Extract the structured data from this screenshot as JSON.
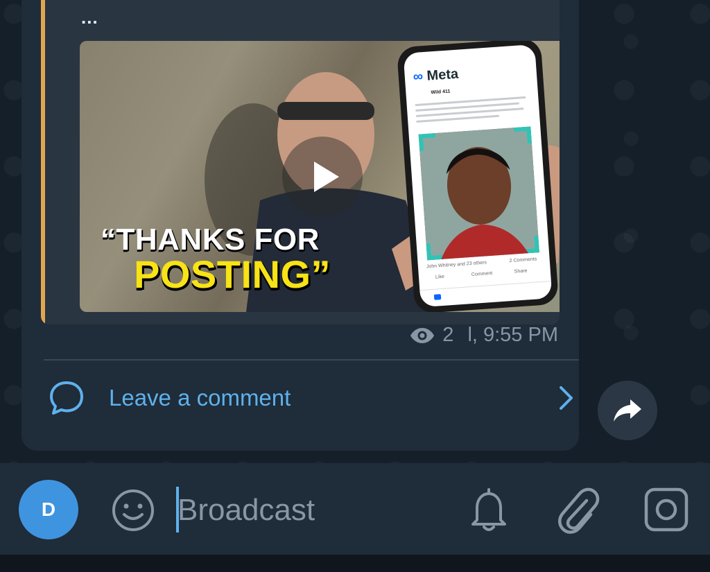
{
  "post": {
    "ellipsis": "...",
    "thumbnail": {
      "caption_line1": "“THANKS FOR",
      "caption_line2": "POSTING”",
      "phone_app": "Meta",
      "phone_post_name": "Wild 411",
      "phone_reactions": "John Whitney and 23 others",
      "phone_comments": "2 Comments",
      "phone_actions": [
        "Like",
        "Comment",
        "Share"
      ]
    },
    "views": "2",
    "time": "l, 9:55 PM"
  },
  "comments": {
    "label": "Leave a comment"
  },
  "composer": {
    "avatar_letter": "D",
    "placeholder": "Broadcast"
  },
  "colors": {
    "accent": "#5eb1ec",
    "reply_bar": "#e2a651",
    "avatar": "#3f94e0"
  }
}
